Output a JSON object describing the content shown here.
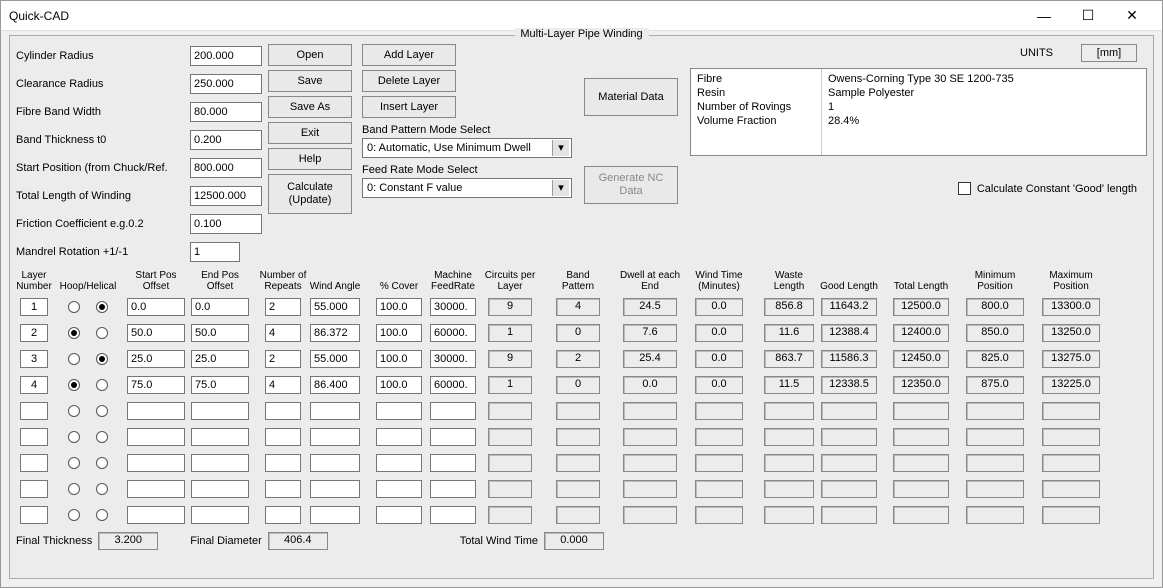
{
  "window": {
    "title": "Quick-CAD"
  },
  "group_title": "Multi-Layer Pipe Winding",
  "params": {
    "cylinder_radius": {
      "label": "Cylinder Radius",
      "value": "200.000"
    },
    "clearance_radius": {
      "label": "Clearance Radius",
      "value": "250.000"
    },
    "fibre_band_width": {
      "label": "Fibre Band Width",
      "value": "80.000"
    },
    "band_thickness": {
      "label": "Band Thickness t0",
      "value": "0.200"
    },
    "start_position": {
      "label": "Start Position (from Chuck/Ref.",
      "value": "800.000"
    },
    "total_length": {
      "label": "Total Length of Winding",
      "value": "12500.000"
    },
    "friction_coeff": {
      "label": "Friction Coefficient e.g.0.2",
      "value": "0.100"
    },
    "mandrel_rotation": {
      "label": "Mandrel Rotation +1/-1",
      "value": "1"
    }
  },
  "buttons": {
    "open": "Open",
    "save": "Save",
    "save_as": "Save As",
    "exit": "Exit",
    "help": "Help",
    "calculate": "Calculate (Update)",
    "add_layer": "Add Layer",
    "delete_layer": "Delete Layer",
    "insert_layer": "Insert Layer",
    "material_data": "Material Data",
    "generate_nc": "Generate NC Data"
  },
  "selects": {
    "band_pattern_label": "Band Pattern Mode Select",
    "band_pattern_value": "0: Automatic, Use Minimum Dwell",
    "feed_rate_label": "Feed Rate Mode Select",
    "feed_rate_value": "0: Constant F value"
  },
  "units": {
    "label": "UNITS",
    "value": "[mm]"
  },
  "material_info": {
    "k1": "Fibre",
    "v1": "Owens-Corning Type 30 SE 1200-735",
    "k2": "Resin",
    "v2": "Sample Polyester",
    "k3": "Number of Rovings",
    "v3": "1",
    "k4": "Volume Fraction",
    "v4": "28.4%"
  },
  "calc_good_label": "Calculate  Constant 'Good' length",
  "headers": {
    "layer": "Layer Number",
    "hoop_helical": "Hoop/Helical",
    "start_pos": "Start Pos Offset",
    "end_pos": "End Pos Offset",
    "num_repeats": "Number of Repeats",
    "wind_angle": "Wind Angle",
    "pct_cover": "% Cover",
    "feed_rate": "Machine FeedRate",
    "circuits": "Circuits per Layer",
    "band_pattern": "Band Pattern",
    "dwell": "Dwell at each End",
    "wind_time": "Wind Time (Minutes)",
    "waste_len": "Waste Length",
    "good_len": "Good Length",
    "total_len": "Total Length",
    "min_pos": "Minimum Position",
    "max_pos": "Maximum Position"
  },
  "layers": [
    {
      "n": "1",
      "hoop": false,
      "helical": true,
      "start": "0.0",
      "end": "0.0",
      "rep": "2",
      "ang": "55.000",
      "cov": "100.0",
      "fr": "30000.",
      "circ": "9",
      "bp": "4",
      "dw": "24.5",
      "wt": "0.0",
      "wl": "856.8",
      "gl": "11643.2",
      "tl": "12500.0",
      "minp": "800.0",
      "maxp": "13300.0"
    },
    {
      "n": "2",
      "hoop": true,
      "helical": false,
      "start": "50.0",
      "end": "50.0",
      "rep": "4",
      "ang": "86.372",
      "cov": "100.0",
      "fr": "60000.",
      "circ": "1",
      "bp": "0",
      "dw": "7.6",
      "wt": "0.0",
      "wl": "11.6",
      "gl": "12388.4",
      "tl": "12400.0",
      "minp": "850.0",
      "maxp": "13250.0"
    },
    {
      "n": "3",
      "hoop": false,
      "helical": true,
      "start": "25.0",
      "end": "25.0",
      "rep": "2",
      "ang": "55.000",
      "cov": "100.0",
      "fr": "30000.",
      "circ": "9",
      "bp": "2",
      "dw": "25.4",
      "wt": "0.0",
      "wl": "863.7",
      "gl": "11586.3",
      "tl": "12450.0",
      "minp": "825.0",
      "maxp": "13275.0"
    },
    {
      "n": "4",
      "hoop": true,
      "helical": false,
      "start": "75.0",
      "end": "75.0",
      "rep": "4",
      "ang": "86.400",
      "cov": "100.0",
      "fr": "60000.",
      "circ": "1",
      "bp": "0",
      "dw": "0.0",
      "wt": "0.0",
      "wl": "11.5",
      "gl": "12338.5",
      "tl": "12350.0",
      "minp": "875.0",
      "maxp": "13225.0"
    },
    {
      "n": "",
      "hoop": false,
      "helical": false,
      "start": "",
      "end": "",
      "rep": "",
      "ang": "",
      "cov": "",
      "fr": "",
      "circ": "",
      "bp": "",
      "dw": "",
      "wt": "",
      "wl": "",
      "gl": "",
      "tl": "",
      "minp": "",
      "maxp": ""
    },
    {
      "n": "",
      "hoop": false,
      "helical": false,
      "start": "",
      "end": "",
      "rep": "",
      "ang": "",
      "cov": "",
      "fr": "",
      "circ": "",
      "bp": "",
      "dw": "",
      "wt": "",
      "wl": "",
      "gl": "",
      "tl": "",
      "minp": "",
      "maxp": ""
    },
    {
      "n": "",
      "hoop": false,
      "helical": false,
      "start": "",
      "end": "",
      "rep": "",
      "ang": "",
      "cov": "",
      "fr": "",
      "circ": "",
      "bp": "",
      "dw": "",
      "wt": "",
      "wl": "",
      "gl": "",
      "tl": "",
      "minp": "",
      "maxp": ""
    },
    {
      "n": "",
      "hoop": false,
      "helical": false,
      "start": "",
      "end": "",
      "rep": "",
      "ang": "",
      "cov": "",
      "fr": "",
      "circ": "",
      "bp": "",
      "dw": "",
      "wt": "",
      "wl": "",
      "gl": "",
      "tl": "",
      "minp": "",
      "maxp": ""
    },
    {
      "n": "",
      "hoop": false,
      "helical": false,
      "start": "",
      "end": "",
      "rep": "",
      "ang": "",
      "cov": "",
      "fr": "",
      "circ": "",
      "bp": "",
      "dw": "",
      "wt": "",
      "wl": "",
      "gl": "",
      "tl": "",
      "minp": "",
      "maxp": ""
    }
  ],
  "footer": {
    "final_thickness_label": "Final Thickness",
    "final_thickness": "3.200",
    "final_diameter_label": "Final Diameter",
    "final_diameter": "406.4",
    "total_wind_time_label": "Total Wind Time",
    "total_wind_time": "0.000"
  }
}
